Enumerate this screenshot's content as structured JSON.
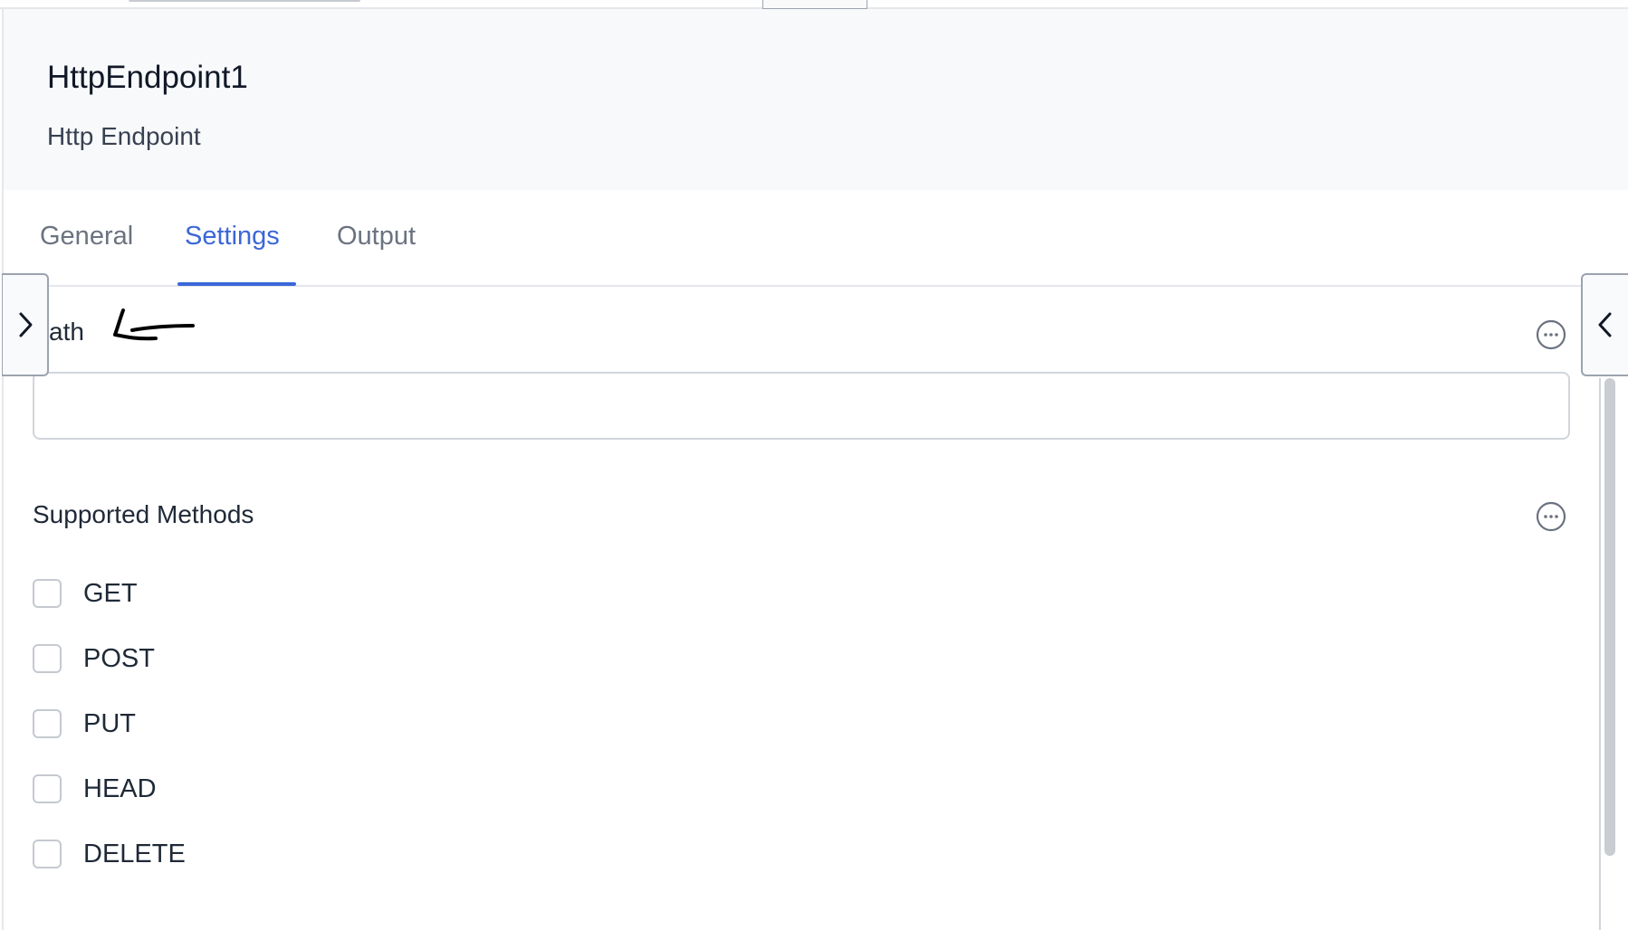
{
  "header": {
    "title": "HttpEndpoint1",
    "subtitle": "Http Endpoint"
  },
  "tabs": [
    {
      "label": "General",
      "active": false
    },
    {
      "label": "Settings",
      "active": true
    },
    {
      "label": "Output",
      "active": false
    }
  ],
  "path_field": {
    "label": "ath",
    "value": "",
    "annotation": "hand-drawn-arrow"
  },
  "supported_methods": {
    "label": "Supported Methods",
    "options": [
      {
        "label": "GET",
        "checked": false
      },
      {
        "label": "POST",
        "checked": false
      },
      {
        "label": "PUT",
        "checked": false
      },
      {
        "label": "HEAD",
        "checked": false
      },
      {
        "label": "DELETE",
        "checked": false
      }
    ]
  },
  "icons": {
    "left_handle": "chevron-right-icon",
    "right_handle": "chevron-left-icon",
    "field_menu": "more-options-icon"
  },
  "colors": {
    "accent": "#3b67d8",
    "header_bg": "#f8f9fb"
  }
}
